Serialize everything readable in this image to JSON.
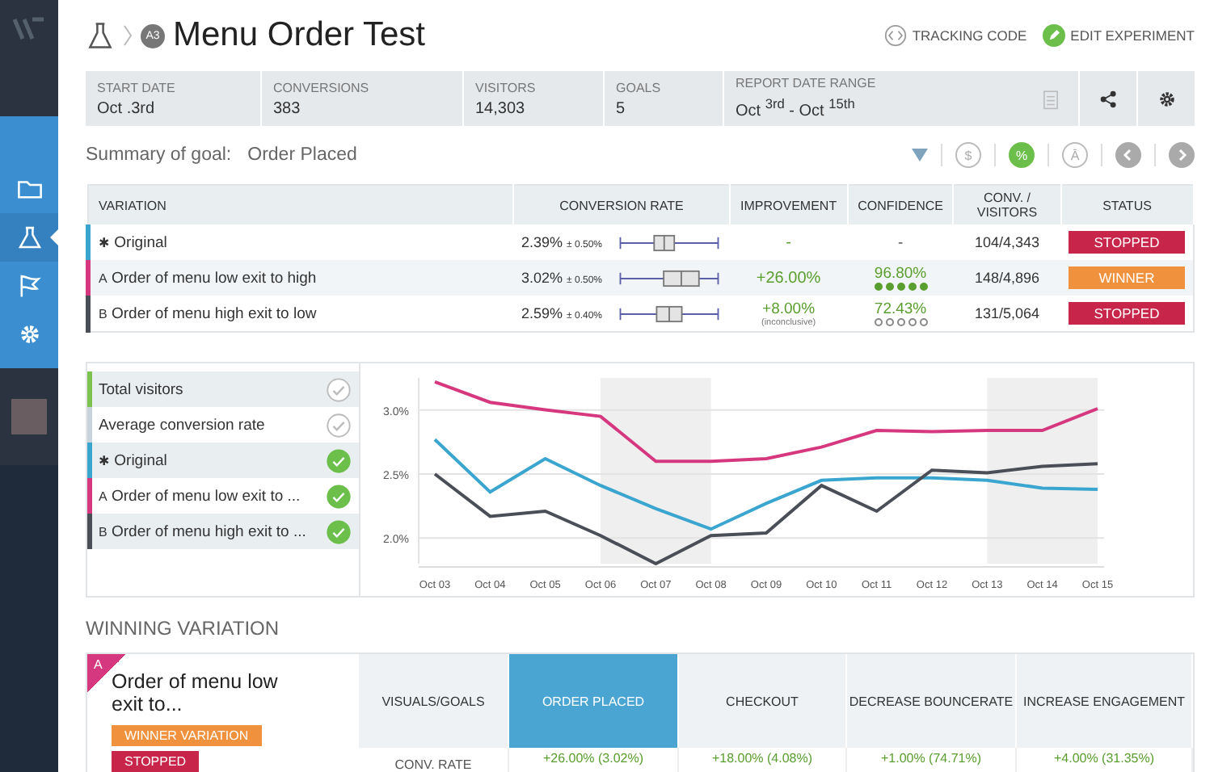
{
  "sidebar": {
    "items": [
      {
        "selected": false
      },
      {
        "selected": true
      },
      {
        "selected": false
      },
      {
        "selected": false
      }
    ]
  },
  "header": {
    "badge": "A3",
    "title": "Menu Order Test",
    "actions": [
      {
        "kind": "code",
        "label": "TRACKING CODE"
      },
      {
        "kind": "edit",
        "label": "EDIT EXPERIMENT"
      }
    ]
  },
  "stats": [
    {
      "label": "START DATE",
      "value": "Oct .3rd"
    },
    {
      "label": "CONVERSIONS",
      "value": "383"
    },
    {
      "label": "VISITORS",
      "value": "14,303"
    },
    {
      "label": "GOALS",
      "value": "5"
    },
    {
      "label": "REPORT DATE RANGE",
      "value": "Oct $^{3rd}$ - Oct $^{15th}$"
    }
  ],
  "summary": {
    "label": "Summary of goal:",
    "goal": "Order Placed",
    "toggles": [
      {
        "symbol": "$",
        "selected": false
      },
      {
        "symbol": "%",
        "selected": true
      },
      {
        "symbol": "Ā",
        "selected": false
      }
    ]
  },
  "table": {
    "columns": [
      "VARIATION",
      "CONVERSION RATE",
      "IMPROVEMENT",
      "CONFIDENCE",
      "CONV. / VISITORS",
      "STATUS"
    ],
    "rows": [
      {
        "mark": "✱",
        "name": "Original",
        "color": "#3aa6cf",
        "rate": "2.39%",
        "margin": "± 0.50%",
        "improvement": "-",
        "confidence": "-",
        "ratio": "104/4,343",
        "status": {
          "label": "STOPPED",
          "color": "#c8254a"
        }
      },
      {
        "mark": "A",
        "name": "Order of menu low exit to high",
        "color": "#d6387f",
        "rate": "3.02%",
        "margin": "± 0.50%",
        "improvement": "+26.00%",
        "confidence": "96.80%",
        "stars": 5,
        "ratio": "148/4,896",
        "status": {
          "label": "WINNER",
          "color": "#f0913d"
        }
      },
      {
        "mark": "B",
        "name": "Order of menu high exit to low",
        "color": "#4a4f57",
        "rate": "2.59%",
        "margin": "± 0.40%",
        "improvement": "+8.00%",
        "note": "(inconclusive)",
        "confidence": "72.43%",
        "stars": 0,
        "ratio": "131/5,064",
        "status": {
          "label": "STOPPED",
          "color": "#c8254a"
        }
      }
    ]
  },
  "legend": [
    {
      "label": "Total visitors",
      "color": "#7cc24e",
      "checked": false
    },
    {
      "label": "Average conversion rate",
      "color": "#c9d3dc",
      "checked": false
    },
    {
      "mark": "✱",
      "label": "Original",
      "color": "#3aa6cf",
      "checked": true
    },
    {
      "mark": "A",
      "label": "Order of menu low exit to ...",
      "color": "#d6387f",
      "checked": true
    },
    {
      "mark": "B",
      "label": "Order of menu high exit to ...",
      "color": "#4a4f57",
      "checked": true
    }
  ],
  "chart_data": {
    "type": "line",
    "categories": [
      "Oct 03",
      "Oct 04",
      "Oct 05",
      "Oct 06",
      "Oct 07",
      "Oct 08",
      "Oct 09",
      "Oct 10",
      "Oct 11",
      "Oct 12",
      "Oct 13",
      "Oct 14",
      "Oct 15"
    ],
    "grid": true,
    "ylim": [
      1.8,
      3.25
    ],
    "yticks": [
      {
        "value": 2.0,
        "label": "2.0%"
      },
      {
        "value": 2.5,
        "label": "2.5%"
      },
      {
        "value": 3.0,
        "label": "3.0%"
      }
    ],
    "series": [
      {
        "color": "#d6387f",
        "values": [
          3.22,
          3.06,
          3.0,
          2.95,
          2.6,
          2.6,
          2.62,
          2.71,
          2.84,
          2.83,
          2.84,
          2.84,
          3.01
        ]
      },
      {
        "color": "#3aa6cf",
        "values": [
          2.77,
          2.36,
          2.62,
          2.41,
          2.23,
          2.07,
          2.27,
          2.45,
          2.47,
          2.47,
          2.45,
          2.39,
          2.38
        ]
      },
      {
        "color": "#4a4f57",
        "values": [
          2.5,
          2.17,
          2.21,
          2.02,
          1.8,
          2.02,
          2.04,
          2.41,
          2.21,
          2.53,
          2.51,
          2.56,
          2.58
        ]
      }
    ]
  },
  "winning": {
    "heading": "WINNING VARIATION",
    "mark": "A",
    "name": "Order of menu low exit to...",
    "tags": [
      {
        "label": "WINNER VARIATION",
        "color": "#f0913d"
      },
      {
        "label": "STOPPED",
        "color": "#c8254a"
      }
    ],
    "columns": [
      {
        "label": "VISUALS/GOALS",
        "selected": false
      },
      {
        "label": "ORDER PLACED",
        "selected": true
      },
      {
        "label": "CHECKOUT",
        "selected": false
      },
      {
        "label": "DECREASE BOUNCERATE",
        "selected": false
      },
      {
        "label": "INCREASE ENGAGEMENT",
        "selected": false
      }
    ],
    "row": [
      "CONV. RATE",
      "+26.00%  (3.02%)",
      "+18.00%  (4.08%)",
      "+1.00%  (74.71%)",
      "+4.00%  (31.35%)"
    ]
  }
}
